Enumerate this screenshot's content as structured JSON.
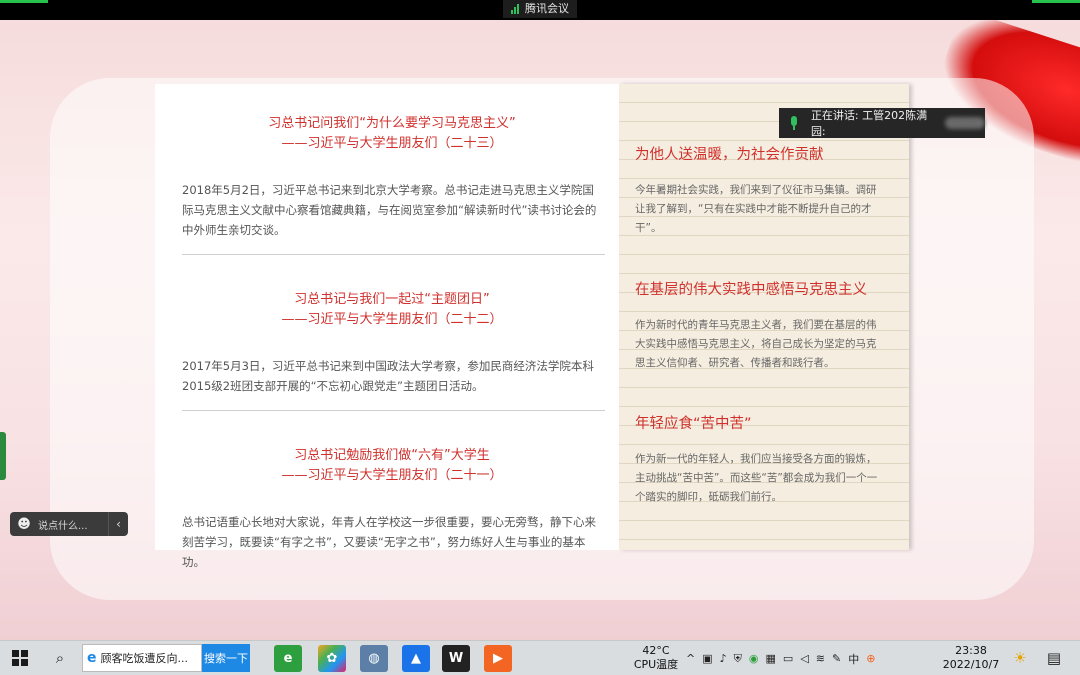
{
  "meeting": {
    "app_title": "腾讯会议",
    "speaker_label": "正在讲话: 工管202陈满园:"
  },
  "left_articles": [
    {
      "title_line1": "习总书记问我们“为什么要学习马克思主义”",
      "title_line2": "——习近平与大学生朋友们（二十三）",
      "body": "2018年5月2日，习近平总书记来到北京大学考察。总书记走进马克思主义学院国际马克思主义文献中心察看馆藏典籍，与在阅览室参加“解读新时代”读书讨论会的中外师生亲切交谈。"
    },
    {
      "title_line1": "习总书记与我们一起过“主题团日”",
      "title_line2": "——习近平与大学生朋友们（二十二）",
      "body": "2017年5月3日，习近平总书记来到中国政法大学考察，参加民商经济法学院本科2015级2班团支部开展的“不忘初心跟党走”主题团日活动。"
    },
    {
      "title_line1": "习总书记勉励我们做“六有”大学生",
      "title_line2": "——习近平与大学生朋友们（二十一）",
      "body": "总书记语重心长地对大家说，年青人在学校这一步很重要，要心无旁骛，静下心来刻苦学习，既要读“有字之书”，又要读“无字之书”，努力练好人生与事业的基本功。"
    }
  ],
  "right_sections": [
    {
      "heading": "为他人送温暖，为社会作贡献",
      "body": "今年暑期社会实践，我们来到了仪征市马集镇。调研让我了解到，“只有在实践中才能不断提升自己的才干”。"
    },
    {
      "heading": "在基层的伟大实践中感悟马克思主义",
      "body": "作为新时代的青年马克思主义者，我们要在基层的伟大实践中感悟马克思主义，将自己成长为坚定的马克思主义信仰者、研究者、传播者和践行者。"
    },
    {
      "heading": "年轻应食“苦中苦”",
      "body": "作为新一代的年轻人，我们应当接受各方面的锻炼，主动挑战“苦中苦”。而这些“苦”都会成为我们一个一个踏实的脚印，砥砺我们前行。"
    }
  ],
  "chat": {
    "placeholder": "说点什么..."
  },
  "taskbar": {
    "search_text": "顾客吃饭遭反向...",
    "search_button": "搜索一下",
    "temperature": "42°C",
    "temperature_label": "CPU温度",
    "ime_label": "中",
    "time": "23:38",
    "date": "2022/10/7"
  },
  "colors": {
    "accent_red": "#d0312d",
    "speaking_green": "#31c060"
  }
}
